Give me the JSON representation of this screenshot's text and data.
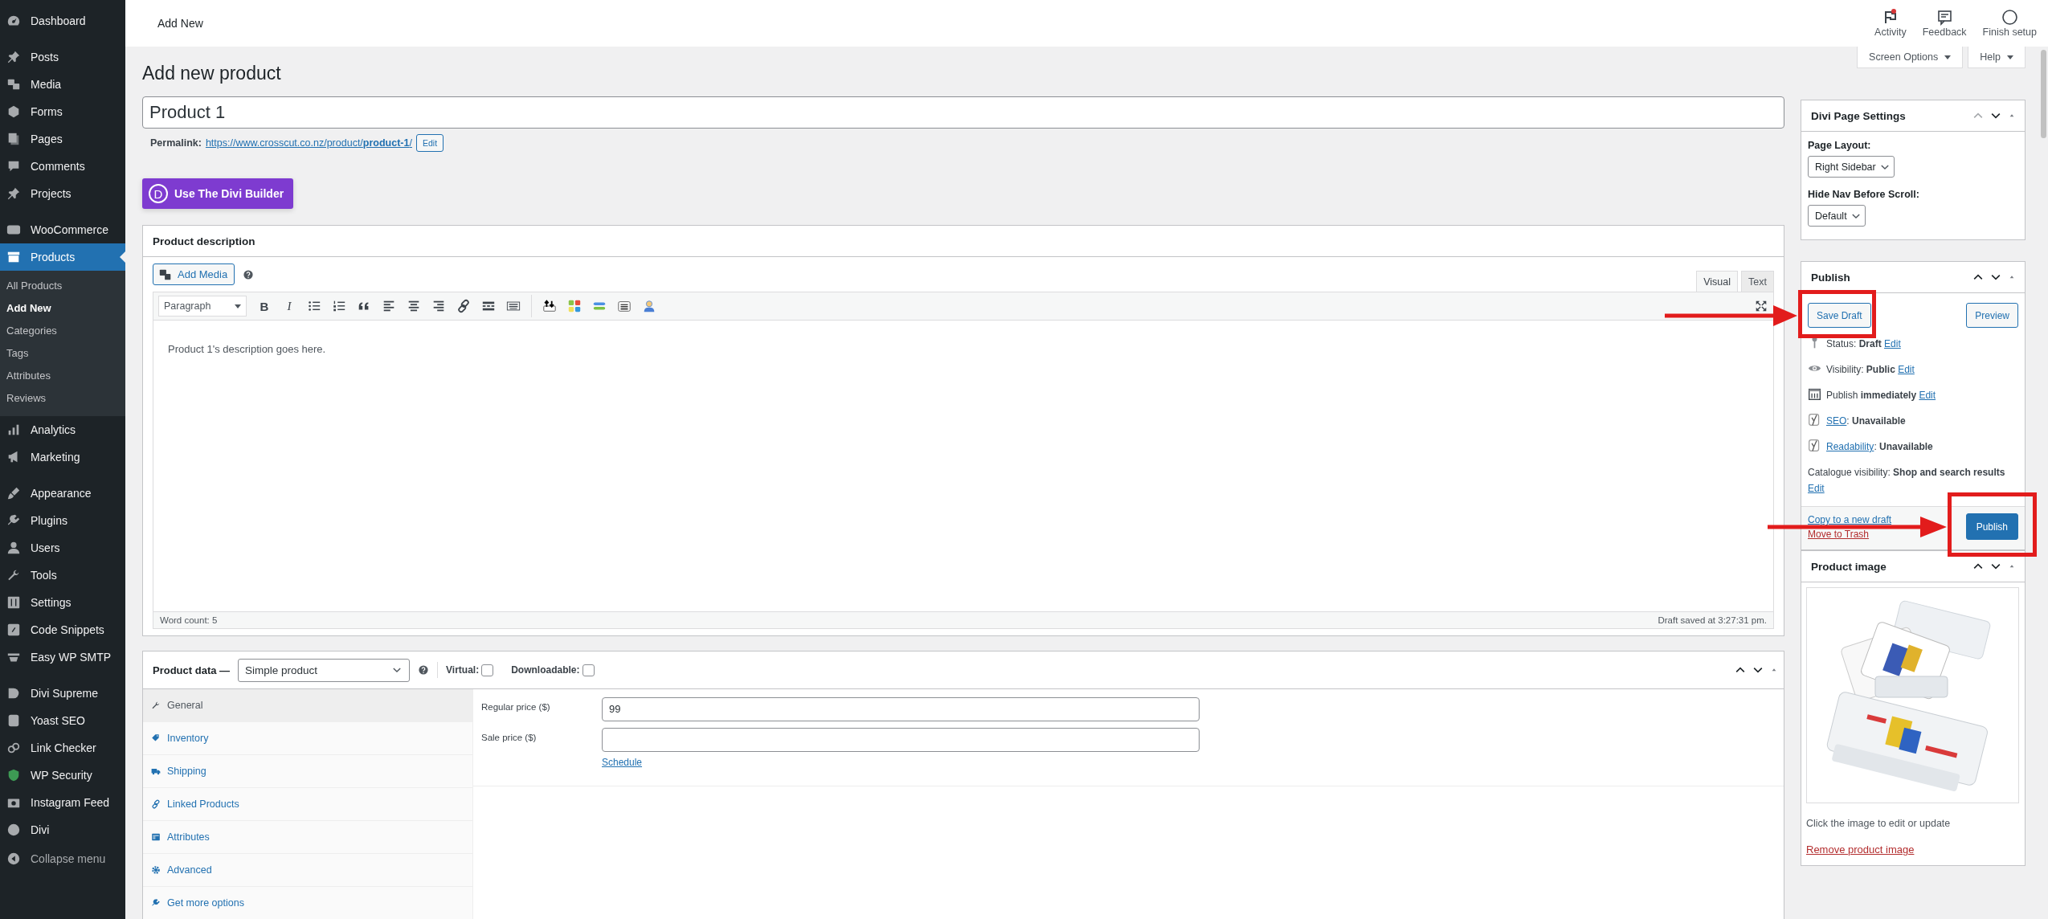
{
  "top_bar": {
    "breadcrumb": "Add New",
    "actions": [
      {
        "label": "Activity",
        "notification": true
      },
      {
        "label": "Feedback",
        "notification": false
      },
      {
        "label": "Finish setup",
        "notification": false
      }
    ]
  },
  "screen_tabs": [
    "Screen Options",
    "Help"
  ],
  "sidebar": {
    "groups": [
      {
        "items": [
          {
            "label": "Dashboard",
            "selected": false
          }
        ]
      },
      {
        "items": [
          {
            "label": "Posts",
            "selected": false
          },
          {
            "label": "Media",
            "selected": false
          },
          {
            "label": "Forms",
            "selected": false
          },
          {
            "label": "Pages",
            "selected": false
          },
          {
            "label": "Comments",
            "selected": false
          },
          {
            "label": "Projects",
            "selected": false
          }
        ]
      },
      {
        "items": [
          {
            "label": "WooCommerce",
            "selected": false
          },
          {
            "label": "Products",
            "selected": true,
            "children": [
              {
                "label": "All Products",
                "selected": false
              },
              {
                "label": "Add New",
                "selected": true
              },
              {
                "label": "Categories",
                "selected": false
              },
              {
                "label": "Tags",
                "selected": false
              },
              {
                "label": "Attributes",
                "selected": false
              },
              {
                "label": "Reviews",
                "selected": false
              }
            ]
          },
          {
            "label": "Analytics",
            "selected": false
          },
          {
            "label": "Marketing",
            "selected": false
          }
        ]
      },
      {
        "items": [
          {
            "label": "Appearance",
            "selected": false
          },
          {
            "label": "Plugins",
            "selected": false
          },
          {
            "label": "Users",
            "selected": false
          },
          {
            "label": "Tools",
            "selected": false
          },
          {
            "label": "Settings",
            "selected": false
          },
          {
            "label": "Code Snippets",
            "selected": false
          },
          {
            "label": "Easy WP SMTP",
            "selected": false
          }
        ]
      },
      {
        "items": [
          {
            "label": "Divi Supreme",
            "selected": false
          },
          {
            "label": "Yoast SEO",
            "selected": false
          },
          {
            "label": "Link Checker",
            "selected": false
          },
          {
            "label": "WP Security",
            "selected": false
          },
          {
            "label": "Instagram Feed",
            "selected": false
          },
          {
            "label": "Divi",
            "selected": false
          }
        ]
      }
    ],
    "collapse": "Collapse menu"
  },
  "page_title": "Add new product",
  "title_field": {
    "value": "Product 1"
  },
  "permalink": {
    "label": "Permalink:",
    "url": "https://www.crosscut.co.nz/product/**product-1**/",
    "edit": "Edit"
  },
  "divi_button": {
    "logo": "D",
    "label": "Use The Divi Builder"
  },
  "editor": {
    "title": "Product description",
    "add_media": "Add Media",
    "tabs": [
      {
        "label": "Visual",
        "selected": true
      },
      {
        "label": "Text",
        "selected": false
      }
    ],
    "format": "Paragraph",
    "bold": "B",
    "italic": "I",
    "content": "Product 1's description goes here.",
    "word_count": "Word count: 5",
    "saved": "Draft saved at 3:27:31 pm."
  },
  "product_data": {
    "title": "Product data —",
    "type": "Simple product",
    "options": [
      {
        "label": "Virtual:",
        "checked": false
      },
      {
        "label": "Downloadable:",
        "checked": false
      }
    ],
    "tabs": [
      {
        "label": "General",
        "selected": true
      },
      {
        "label": "Inventory",
        "selected": false
      },
      {
        "label": "Shipping",
        "selected": false
      },
      {
        "label": "Linked Products",
        "selected": false
      },
      {
        "label": "Attributes",
        "selected": false
      },
      {
        "label": "Advanced",
        "selected": false
      },
      {
        "label": "Get more options",
        "selected": false
      }
    ],
    "fields": [
      {
        "label": "Regular price ($)",
        "value": "99"
      },
      {
        "label": "Sale price ($)",
        "link": "Schedule"
      }
    ]
  },
  "divi_settings": {
    "title": "Divi Page Settings",
    "fields": [
      {
        "label": "Page Layout:",
        "value": "Right Sidebar"
      },
      {
        "label": "Hide Nav Before Scroll:",
        "value": "Default"
      }
    ]
  },
  "publish": {
    "title": "Publish",
    "save_draft": {
      "label": "Save Draft",
      "highlighted": true
    },
    "preview": "Preview",
    "rows": [
      {
        "parts": [
          {
            "kind": "text",
            "text": "Status: **Draft**"
          },
          {
            "kind": "link",
            "text": "Edit"
          }
        ]
      },
      {
        "parts": [
          {
            "kind": "text",
            "text": "Visibility: **Public**"
          },
          {
            "kind": "link",
            "text": "Edit"
          }
        ]
      },
      {
        "parts": [
          {
            "kind": "text",
            "text": "Publish **immediately**"
          },
          {
            "kind": "link",
            "text": "Edit"
          }
        ]
      },
      {
        "parts": [
          {
            "kind": "link",
            "text": "SEO"
          },
          {
            "kind": "text",
            "text": ": **Unavailable**"
          }
        ]
      },
      {
        "parts": [
          {
            "kind": "link",
            "text": "Readability"
          },
          {
            "kind": "text",
            "text": ": **Unavailable**"
          }
        ]
      },
      {
        "parts": [
          {
            "kind": "text",
            "text": "Catalogue visibility: **Shop and search results**"
          },
          {
            "kind": "link",
            "text": "Edit"
          }
        ]
      }
    ],
    "copy_link": "Copy to a new draft",
    "trash_link": "Move to Trash",
    "publish_button": {
      "label": "Publish",
      "highlighted": true
    }
  },
  "product_image": {
    "title": "Product image",
    "hint": "Click the image to edit or update",
    "remove": "Remove product image"
  }
}
